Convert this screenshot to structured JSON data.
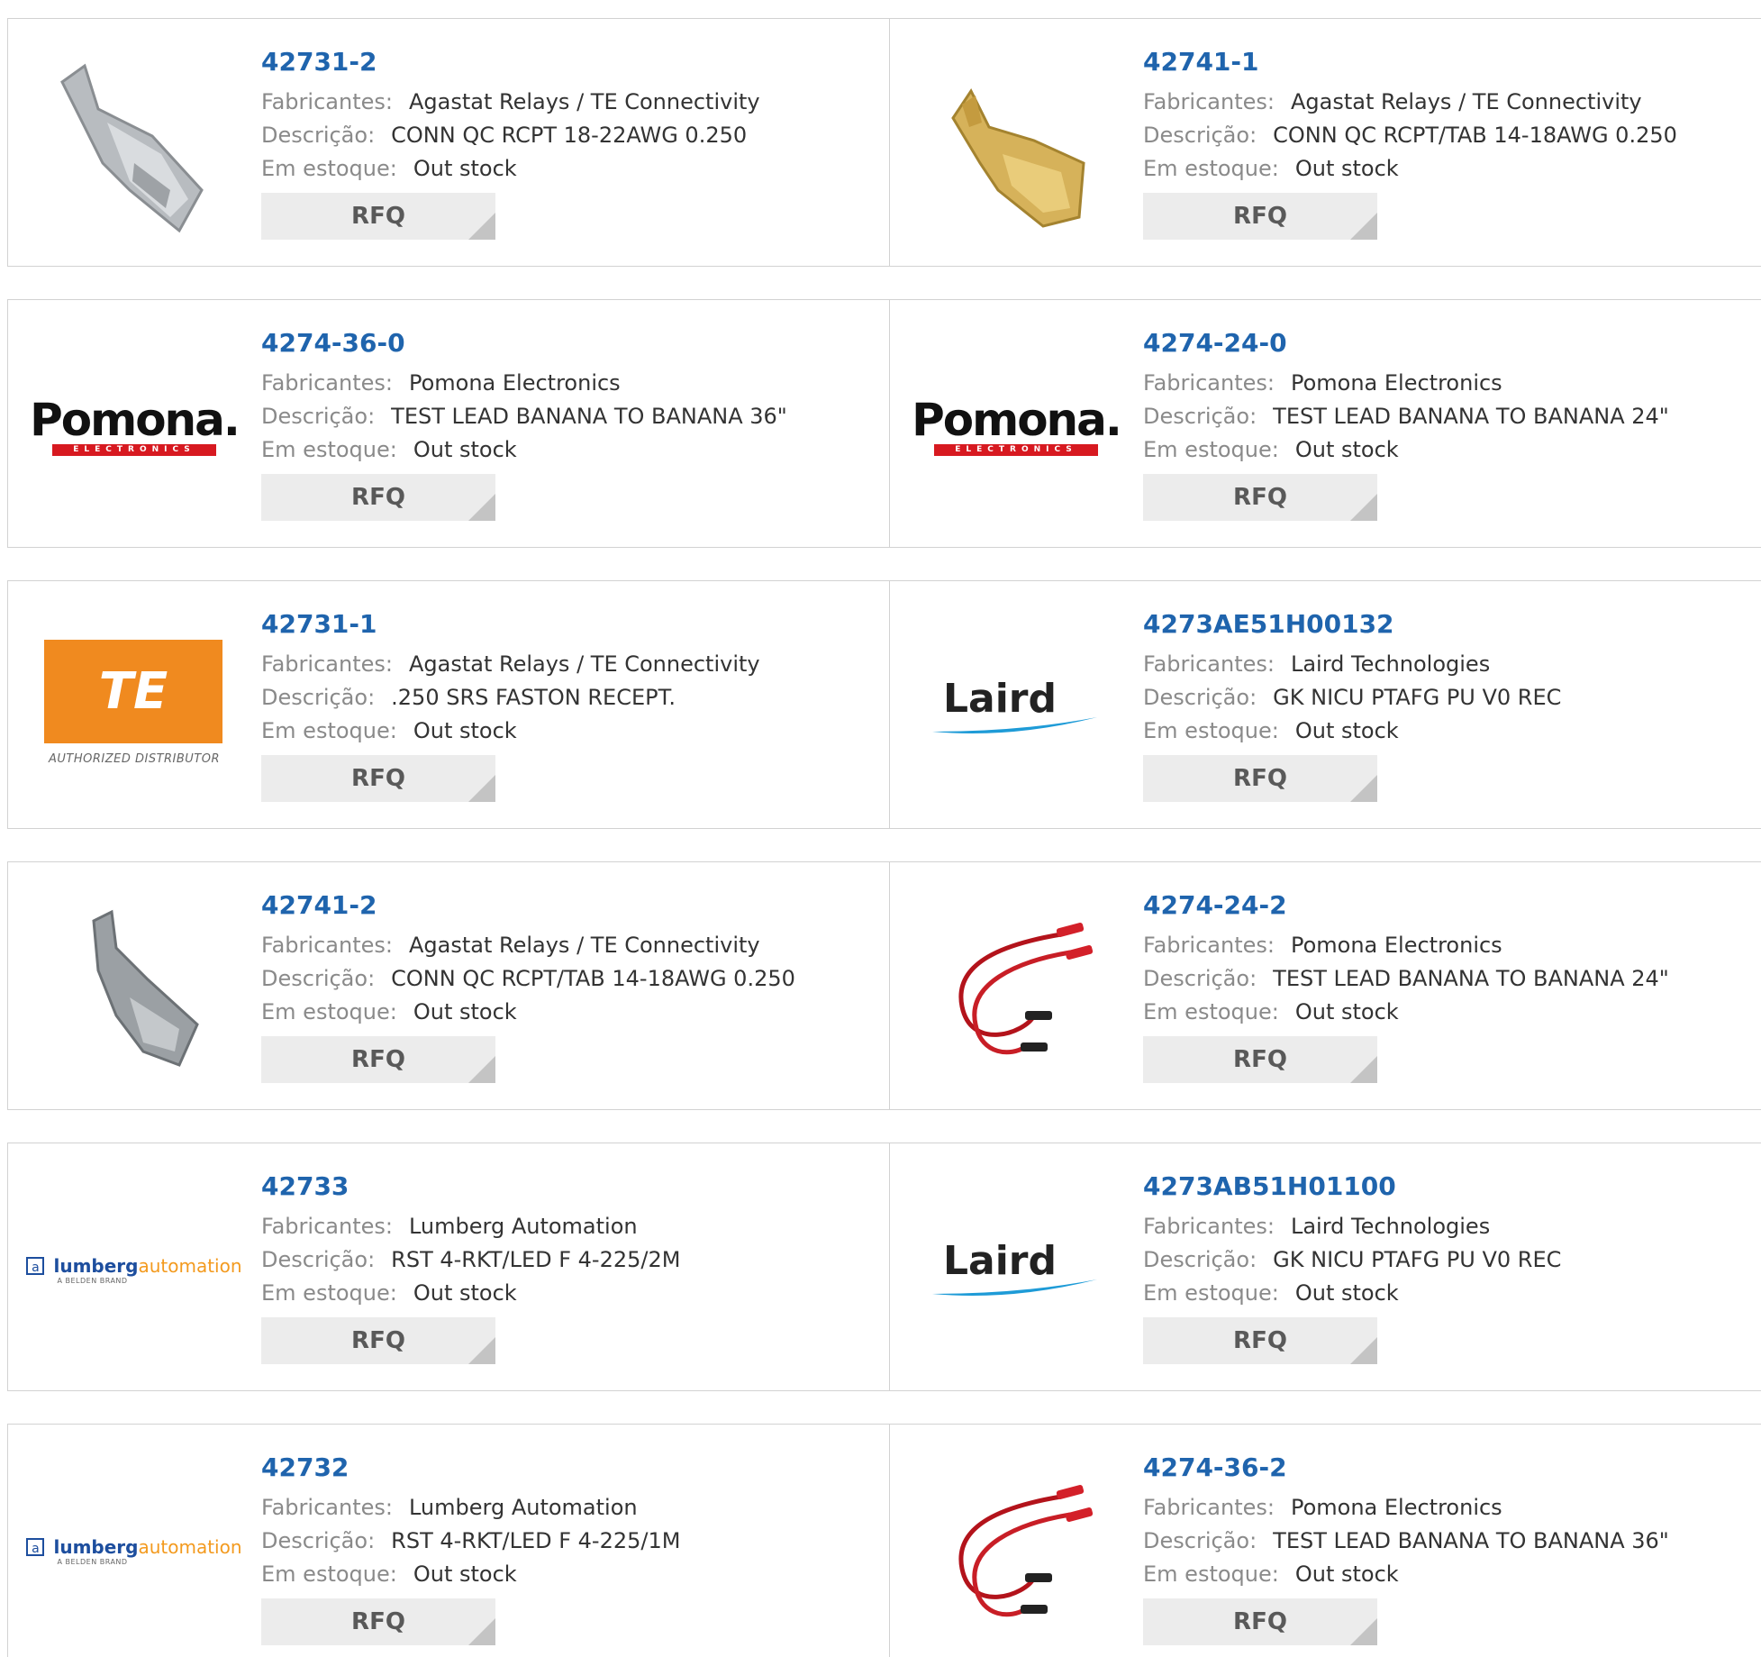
{
  "labels": {
    "manufacturer": "Fabricantes:",
    "description": "Descrição:",
    "stock": "Em estoque:",
    "rfq": "RFQ"
  },
  "colors": {
    "part_number": "#1f64ad",
    "label": "#8a8a8a",
    "rfq_bg": "#ececec"
  },
  "products": [
    {
      "part": "42731-2",
      "manufacturer": "Agastat Relays / TE Connectivity",
      "description": "CONN QC RCPT 18-22AWG 0.250",
      "stock": "Out stock",
      "thumb": "terminal-silver-photo"
    },
    {
      "part": "42741-1",
      "manufacturer": "Agastat Relays / TE Connectivity",
      "description": "CONN QC RCPT/TAB 14-18AWG 0.250",
      "stock": "Out stock",
      "thumb": "terminal-gold-photo"
    },
    {
      "part": "4274-36-0",
      "manufacturer": "Pomona Electronics",
      "description": "TEST LEAD BANANA TO BANANA 36\"",
      "stock": "Out stock",
      "thumb": "pomona-logo",
      "logo_text": "Pomona.",
      "logo_sub": "ELECTRONICS"
    },
    {
      "part": "4274-24-0",
      "manufacturer": "Pomona Electronics",
      "description": "TEST LEAD BANANA TO BANANA 24\"",
      "stock": "Out stock",
      "thumb": "pomona-logo",
      "logo_text": "Pomona.",
      "logo_sub": "ELECTRONICS"
    },
    {
      "part": "42731-1",
      "manufacturer": "Agastat Relays / TE Connectivity",
      "description": ".250 SRS FASTON RECEPT.",
      "stock": "Out stock",
      "thumb": "te-logo",
      "logo_text": "TE",
      "logo_sub": "AUTHORIZED DISTRIBUTOR"
    },
    {
      "part": "4273AE51H00132",
      "manufacturer": "Laird Technologies",
      "description": "GK NICU PTAFG PU V0 REC",
      "stock": "Out stock",
      "thumb": "laird-logo",
      "logo_text": "Laird"
    },
    {
      "part": "42741-2",
      "manufacturer": "Agastat Relays / TE Connectivity",
      "description": "CONN QC RCPT/TAB 14-18AWG 0.250",
      "stock": "Out stock",
      "thumb": "terminal-silver-photo"
    },
    {
      "part": "4274-24-2",
      "manufacturer": "Pomona Electronics",
      "description": "TEST LEAD BANANA TO BANANA 24\"",
      "stock": "Out stock",
      "thumb": "red-test-lead-photo"
    },
    {
      "part": "42733",
      "manufacturer": "Lumberg Automation",
      "description": "RST 4-RKT/LED F 4-225/2M",
      "stock": "Out stock",
      "thumb": "lumberg-logo",
      "logo_text_a": "lumberg",
      "logo_text_b": "automation",
      "logo_sub": "A BELDEN BRAND"
    },
    {
      "part": "4273AB51H01100",
      "manufacturer": "Laird Technologies",
      "description": "GK NICU PTAFG PU V0 REC",
      "stock": "Out stock",
      "thumb": "laird-logo",
      "logo_text": "Laird"
    },
    {
      "part": "42732",
      "manufacturer": "Lumberg Automation",
      "description": "RST 4-RKT/LED F 4-225/1M",
      "stock": "Out stock",
      "thumb": "lumberg-logo",
      "logo_text_a": "lumberg",
      "logo_text_b": "automation",
      "logo_sub": "A BELDEN BRAND"
    },
    {
      "part": "4274-36-2",
      "manufacturer": "Pomona Electronics",
      "description": "TEST LEAD BANANA TO BANANA 36\"",
      "stock": "Out stock",
      "thumb": "red-test-lead-photo"
    }
  ]
}
